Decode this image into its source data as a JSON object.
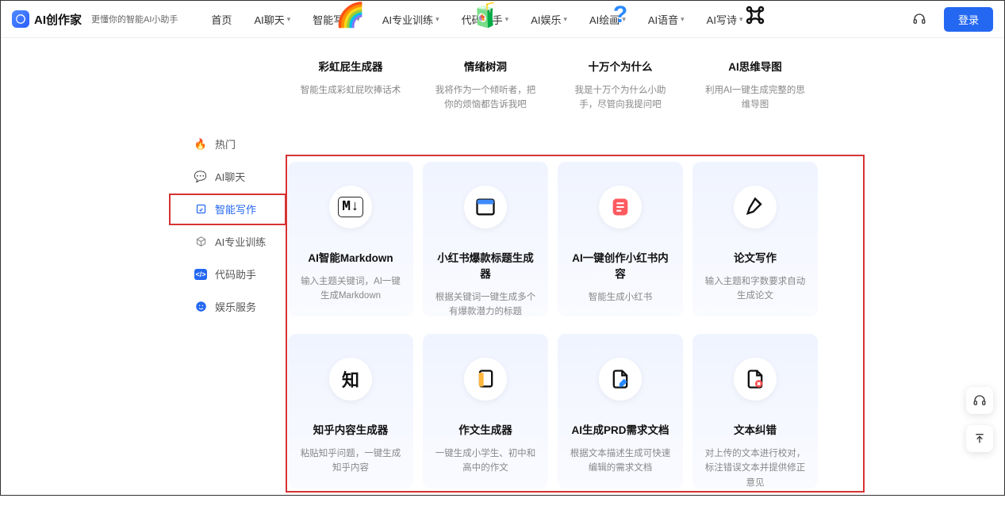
{
  "brand": {
    "name": "AI创作家",
    "tagline": "更懂你的智能AI小助手"
  },
  "nav": {
    "items": [
      {
        "label": "首页",
        "dropdown": false
      },
      {
        "label": "AI聊天",
        "dropdown": true
      },
      {
        "label": "智能写作",
        "dropdown": true
      },
      {
        "label": "AI专业训练",
        "dropdown": true
      },
      {
        "label": "代码助手",
        "dropdown": true
      },
      {
        "label": "AI娱乐",
        "dropdown": true
      },
      {
        "label": "AI绘画",
        "dropdown": true
      },
      {
        "label": "AI语音",
        "dropdown": true
      },
      {
        "label": "AI写诗",
        "dropdown": true
      }
    ],
    "login": "登录"
  },
  "sidebar": {
    "items": [
      {
        "label": "热门",
        "icon": "flame"
      },
      {
        "label": "AI聊天",
        "icon": "chat"
      },
      {
        "label": "智能写作",
        "icon": "edit",
        "active": true
      },
      {
        "label": "AI专业训练",
        "icon": "cube"
      },
      {
        "label": "代码助手",
        "icon": "code"
      },
      {
        "label": "娱乐服务",
        "icon": "smile"
      }
    ]
  },
  "rows": [
    [
      {
        "title": "彩虹屁生成器",
        "desc": "智能生成彩虹屁吹捧话术",
        "emoji": "🌈"
      },
      {
        "title": "情绪树洞",
        "desc": "我将作为一个倾听者，把你的烦恼都告诉我吧",
        "emoji": "🧃"
      },
      {
        "title": "十万个为什么",
        "desc": "我是十万个为什么小助手，尽管向我提问吧",
        "emoji": "❓"
      },
      {
        "title": "AI思维导图",
        "desc": "利用AI一键生成完整的思维导图",
        "emoji": "🔗"
      }
    ],
    [
      {
        "title": "AI智能Markdown",
        "desc": "输入主题关键词，AI一键生成Markdown",
        "emoji": "M↓"
      },
      {
        "title": "小红书爆款标题生成器",
        "desc": "根据关键词一键生成多个有爆款潜力的标题",
        "emoji": "📘"
      },
      {
        "title": "AI一键创作小红书内容",
        "desc": "智能生成小红书",
        "emoji": "📕"
      },
      {
        "title": "论文写作",
        "desc": "输入主题和字数要求自动生成论文",
        "emoji": "✒️"
      }
    ],
    [
      {
        "title": "知乎内容生成器",
        "desc": "粘贴知乎问题，一键生成知乎内容",
        "emoji": "知"
      },
      {
        "title": "作文生成器",
        "desc": "一键生成小学生、初中和高中的作文",
        "emoji": "📄"
      },
      {
        "title": "AI生成PRD需求文档",
        "desc": "根据文本描述生成可快速编辑的需求文档",
        "emoji": "📝"
      },
      {
        "title": "文本纠错",
        "desc": "对上传的文本进行校对，标注错误文本并提供修正意见",
        "emoji": "🗑️"
      }
    ]
  ]
}
